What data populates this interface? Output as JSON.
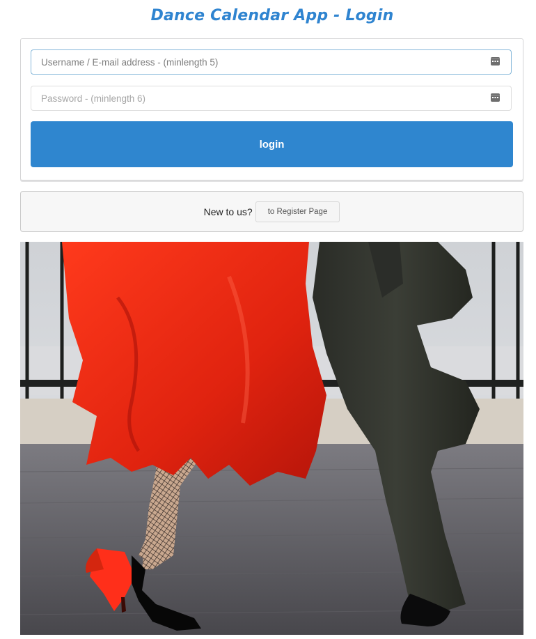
{
  "title": "Dance Calendar App - Login",
  "login_form": {
    "username_placeholder": "Username / E-mail address - (minlength 5)",
    "password_placeholder": "Password - (minlength 6)",
    "login_label": "login"
  },
  "register": {
    "prompt": "New to us?",
    "button_label": "to Register Page"
  },
  "colors": {
    "title": "#2f84d0",
    "primary_button": "#2f86cf"
  },
  "icons": {
    "field_icon": "password-manager-key-icon"
  }
}
